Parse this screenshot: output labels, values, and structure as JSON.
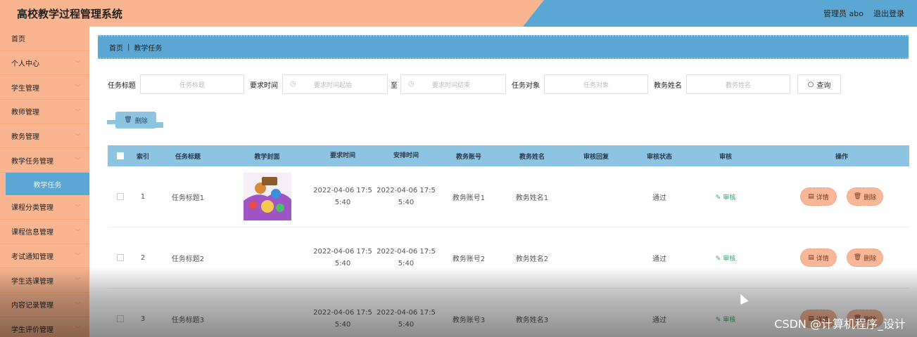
{
  "header": {
    "title": "高校教学过程管理系统",
    "user_label": "管理员 abo",
    "logout_label": "退出登录"
  },
  "sidebar": {
    "items": [
      {
        "label": "首页",
        "chevron": false
      },
      {
        "label": "个人中心",
        "chevron": true
      },
      {
        "label": "学生管理",
        "chevron": true
      },
      {
        "label": "教师管理",
        "chevron": true
      },
      {
        "label": "教务管理",
        "chevron": true
      },
      {
        "label": "教学任务管理",
        "chevron": true
      },
      {
        "label": "课程分类管理",
        "chevron": true
      },
      {
        "label": "课程信息管理",
        "chevron": true
      },
      {
        "label": "考试通知管理",
        "chevron": true
      },
      {
        "label": "学生选课管理",
        "chevron": true
      },
      {
        "label": "内容记录管理",
        "chevron": true
      },
      {
        "label": "学生评价管理",
        "chevron": true
      }
    ],
    "active_sub": "教学任务"
  },
  "breadcrumb": {
    "home": "首页",
    "current": "教学任务"
  },
  "search": {
    "title_label": "任务标题",
    "title_placeholder": "任务标题",
    "time_label": "要求时间",
    "time_start_placeholder": "要求时间起始",
    "to_label": "至",
    "time_end_placeholder": "要求时间结束",
    "target_label": "任务对象",
    "target_placeholder": "任务对象",
    "name_label": "教务姓名",
    "name_placeholder": "教务姓名",
    "query_label": "查询"
  },
  "actions": {
    "delete_label": "删除"
  },
  "table": {
    "columns": [
      "索引",
      "任务标题",
      "教学封面",
      "要求时间",
      "安排时间",
      "教务账号",
      "教务姓名",
      "审核回复",
      "审核状态",
      "审核",
      "操作"
    ],
    "rows": [
      {
        "index": "1",
        "title": "任务标题1",
        "req_time_1": "2022-04-06 17:5",
        "req_time_2": "5:40",
        "arr_time_1": "2022-04-06 17:5",
        "arr_time_2": "5:40",
        "account": "教务账号1",
        "name": "教务姓名1",
        "reply": "",
        "status": "通过",
        "audit": "审核",
        "detail": "详情",
        "delete": "删除"
      },
      {
        "index": "2",
        "title": "任务标题2",
        "req_time_1": "2022-04-06 17:5",
        "req_time_2": "5:40",
        "arr_time_1": "2022-04-06 17:5",
        "arr_time_2": "5:40",
        "account": "教务账号2",
        "name": "教务姓名2",
        "reply": "",
        "status": "通过",
        "audit": "审核",
        "detail": "详情",
        "delete": "删除"
      },
      {
        "index": "3",
        "title": "任务标题3",
        "req_time_1": "2022-04-06 17:5",
        "req_time_2": "5:40",
        "arr_time_1": "2022-04-06 17:5",
        "arr_time_2": "5:40",
        "account": "教务账号3",
        "name": "教务姓名3",
        "reply": "",
        "status": "通过",
        "audit": "审核",
        "detail": "详情",
        "delete": "删除"
      }
    ]
  },
  "watermark": "CSDN @计算机程序_设计",
  "colors": {
    "peach": "#f9b58f",
    "blue": "#5ba7d3",
    "light_blue": "#8dc4e2",
    "audit_green": "#3aa56d"
  }
}
